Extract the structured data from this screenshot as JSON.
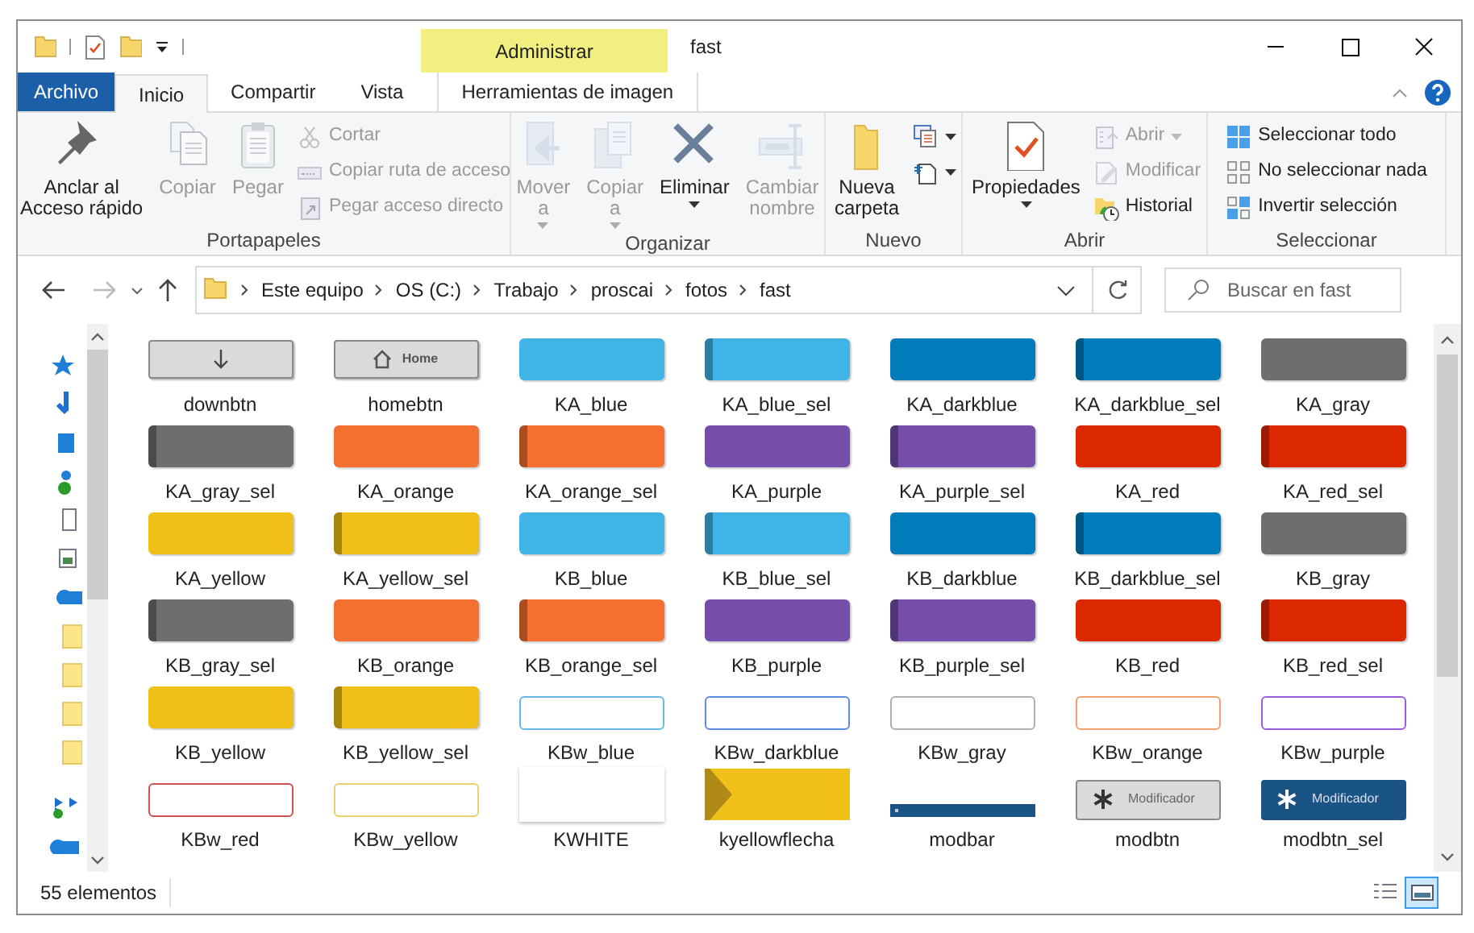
{
  "title_bar": {
    "context_tab": "Administrar",
    "title": "fast"
  },
  "tabs": [
    {
      "label": "Archivo",
      "kind": "file",
      "selected": false
    },
    {
      "label": "Inicio",
      "kind": "tab",
      "selected": true
    },
    {
      "label": "Compartir",
      "kind": "tab",
      "selected": false
    },
    {
      "label": "Vista",
      "kind": "tab",
      "selected": false
    },
    {
      "label": "Herramientas de imagen",
      "kind": "context",
      "selected": false
    }
  ],
  "ribbon": {
    "groups": [
      {
        "label": "Portapapeles",
        "buttons": [
          {
            "label": "Anclar al\nAcceso rápido",
            "kind": "large",
            "disabled": false,
            "dropdown": false
          },
          {
            "label": "Copiar",
            "kind": "large",
            "disabled": true,
            "dropdown": false
          },
          {
            "label": "Pegar",
            "kind": "large",
            "disabled": true,
            "dropdown": false
          },
          {
            "label": "Cortar",
            "kind": "small",
            "disabled": true,
            "dropdown": false
          },
          {
            "label": "Copiar ruta de acceso",
            "kind": "small",
            "disabled": true,
            "dropdown": false
          },
          {
            "label": "Pegar acceso directo",
            "kind": "small",
            "disabled": true,
            "dropdown": false
          }
        ]
      },
      {
        "label": "Organizar",
        "buttons": [
          {
            "label": "Mover\na",
            "kind": "large",
            "disabled": true,
            "dropdown": true
          },
          {
            "label": "Copiar\na",
            "kind": "large",
            "disabled": true,
            "dropdown": true
          },
          {
            "label": "Eliminar",
            "kind": "large",
            "disabled": false,
            "dropdown": true
          },
          {
            "label": "Cambiar\nnombre",
            "kind": "large",
            "disabled": true,
            "dropdown": false
          }
        ]
      },
      {
        "label": "Nuevo",
        "buttons": [
          {
            "label": "Nueva\ncarpeta",
            "kind": "large",
            "disabled": false,
            "dropdown": false
          },
          {
            "kind": "icon",
            "disabled": false,
            "dropdown": true
          },
          {
            "kind": "icon",
            "disabled": false,
            "dropdown": true
          }
        ]
      },
      {
        "label": "Abrir",
        "buttons": [
          {
            "label": "Propiedades",
            "kind": "large",
            "disabled": false,
            "dropdown": true
          },
          {
            "label": "Abrir",
            "kind": "small",
            "disabled": true,
            "dropdown": true
          },
          {
            "label": "Modificar",
            "kind": "small",
            "disabled": true,
            "dropdown": false
          },
          {
            "label": "Historial",
            "kind": "small",
            "disabled": false,
            "dropdown": false
          }
        ]
      },
      {
        "label": "Seleccionar",
        "buttons": [
          {
            "label": "Seleccionar todo",
            "kind": "small",
            "disabled": false,
            "dropdown": false
          },
          {
            "label": "No seleccionar nada",
            "kind": "small",
            "disabled": false,
            "dropdown": false
          },
          {
            "label": "Invertir selección",
            "kind": "small",
            "disabled": false,
            "dropdown": false
          }
        ]
      }
    ]
  },
  "address_bar": {
    "path": [
      "Este equipo",
      "OS (C:)",
      "Trabajo",
      "proscai",
      "fotos",
      "fast"
    ],
    "search": {
      "placeholder": "Buscar en fast"
    }
  },
  "files": [
    {
      "name": "downbtn",
      "kind": "gray_button"
    },
    {
      "name": "homebtn",
      "kind": "gray_button",
      "text": "Home"
    },
    {
      "name": "KA_blue",
      "kind": "solid",
      "color": "#41b4e6"
    },
    {
      "name": "KA_blue_sel",
      "kind": "striped",
      "color": "#41b4e6"
    },
    {
      "name": "KA_darkblue",
      "kind": "solid",
      "color": "#027bbb"
    },
    {
      "name": "KA_darkblue_sel",
      "kind": "striped",
      "color": "#027bbb"
    },
    {
      "name": "KA_gray",
      "kind": "solid",
      "color": "#6e6e6e"
    },
    {
      "name": "KA_gray_sel",
      "kind": "striped",
      "color": "#6e6e6e"
    },
    {
      "name": "KA_orange",
      "kind": "solid",
      "color": "#f37030"
    },
    {
      "name": "KA_orange_sel",
      "kind": "striped",
      "color": "#f37030"
    },
    {
      "name": "KA_purple",
      "kind": "solid",
      "color": "#744ea8"
    },
    {
      "name": "KA_purple_sel",
      "kind": "striped",
      "color": "#744ea8"
    },
    {
      "name": "KA_red",
      "kind": "solid",
      "color": "#dc2800"
    },
    {
      "name": "KA_red_sel",
      "kind": "striped",
      "color": "#dc2800"
    },
    {
      "name": "KA_yellow",
      "kind": "solid",
      "color": "#f0c018"
    },
    {
      "name": "KA_yellow_sel",
      "kind": "striped",
      "color": "#f0c018"
    },
    {
      "name": "KB_blue",
      "kind": "solid",
      "color": "#41b4e6"
    },
    {
      "name": "KB_blue_sel",
      "kind": "striped",
      "color": "#41b4e6"
    },
    {
      "name": "KB_darkblue",
      "kind": "solid",
      "color": "#027bbb"
    },
    {
      "name": "KB_darkblue_sel",
      "kind": "striped",
      "color": "#027bbb"
    },
    {
      "name": "KB_gray",
      "kind": "solid",
      "color": "#6e6e6e"
    },
    {
      "name": "KB_gray_sel",
      "kind": "striped",
      "color": "#6e6e6e"
    },
    {
      "name": "KB_orange",
      "kind": "solid",
      "color": "#f37030"
    },
    {
      "name": "KB_orange_sel",
      "kind": "striped",
      "color": "#f37030"
    },
    {
      "name": "KB_purple",
      "kind": "solid",
      "color": "#744ea8"
    },
    {
      "name": "KB_purple_sel",
      "kind": "striped",
      "color": "#744ea8"
    },
    {
      "name": "KB_red",
      "kind": "solid",
      "color": "#dc2800"
    },
    {
      "name": "KB_red_sel",
      "kind": "striped",
      "color": "#dc2800"
    },
    {
      "name": "KB_yellow",
      "kind": "solid",
      "color": "#f0c018"
    },
    {
      "name": "KB_yellow_sel",
      "kind": "striped",
      "color": "#f0c018"
    },
    {
      "name": "KBw_blue",
      "kind": "outline",
      "color": "#66b8e8"
    },
    {
      "name": "KBw_darkblue",
      "kind": "outline",
      "color": "#5b8ee0"
    },
    {
      "name": "KBw_gray",
      "kind": "outline",
      "color": "#b0b0b0"
    },
    {
      "name": "KBw_orange",
      "kind": "outline",
      "color": "#f0a070"
    },
    {
      "name": "KBw_purple",
      "kind": "outline",
      "color": "#9a5de0"
    },
    {
      "name": "KBw_red",
      "kind": "outline",
      "color": "#d05050"
    },
    {
      "name": "KBw_yellow",
      "kind": "outline",
      "color": "#e8d070"
    },
    {
      "name": "KWHITE",
      "kind": "plain"
    },
    {
      "name": "kyellowflecha",
      "kind": "arrow",
      "color": "#f0c018"
    },
    {
      "name": "modbar",
      "kind": "bar",
      "color": "#1a5485"
    },
    {
      "name": "modbtn",
      "kind": "mod_button",
      "text": "Modificador"
    },
    {
      "name": "modbtn_sel",
      "kind": "mod_button_dark",
      "text": "Modificador",
      "color": "#1a5485"
    }
  ],
  "status_bar": {
    "count": "55 elementos",
    "views": [
      {
        "kind": "details",
        "selected": false
      },
      {
        "kind": "large_icons",
        "selected": true
      }
    ]
  }
}
